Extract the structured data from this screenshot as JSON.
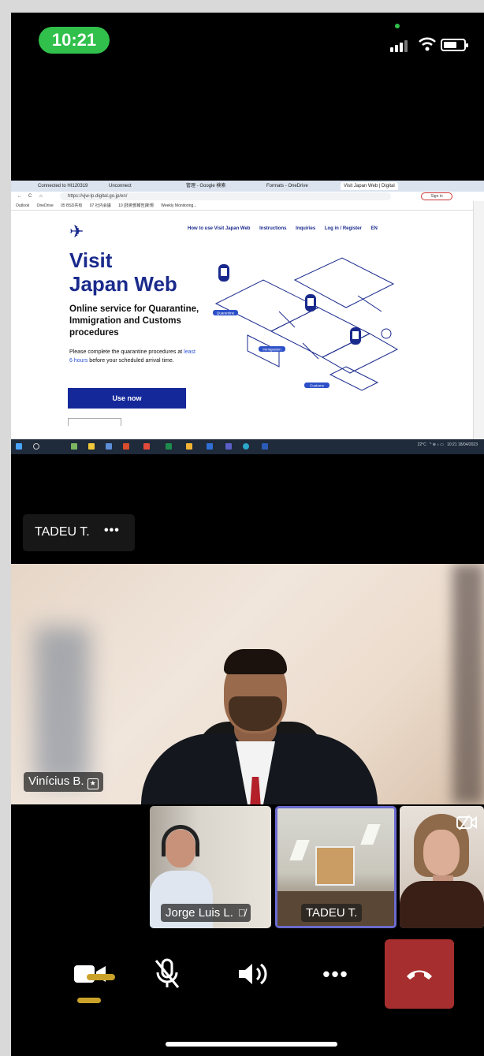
{
  "status_bar": {
    "time": "10:21"
  },
  "shared_screen": {
    "browser": {
      "tabs": [
        "Connected to HI120319",
        "Unconnect",
        "管理 - Google 検索",
        "Formats - OneDrive",
        "Visit Japan Web | Digital"
      ],
      "url": "https://vjw-lp.digital.go.jp/en/",
      "sign_in": "Sign in",
      "favorites": [
        "Outlook",
        "OneDrive",
        "05 BSD共有",
        "07 社内会議",
        "10 [技術部報告]新規",
        "Weekly Monitoring..."
      ]
    },
    "website": {
      "nav": [
        "How to use Visit Japan Web",
        "Instructions",
        "Inquiries",
        "Log in / Register",
        "EN"
      ],
      "title_line1": "Visit",
      "title_line2": "Japan Web",
      "subtitle": "Online service for Quarantine, Immigration and Customs procedures",
      "desc_before": "Please complete the quarantine procedures at ",
      "desc_highlight": "least 6 hours",
      "desc_after": " before your scheduled arrival time.",
      "cta": "Use now",
      "illustration_labels": [
        "Quarantine",
        "Immigration",
        "Customs"
      ]
    },
    "taskbar": {
      "weather": "22°C",
      "clock_time": "10:21",
      "clock_date": "18/04/2023"
    }
  },
  "presenter": {
    "name": "TADEU T.",
    "more": "•••"
  },
  "participants": {
    "main": {
      "name": "Vinícius B."
    },
    "thumbs": [
      {
        "name": "Jorge Luis L."
      },
      {
        "name": "TADEU T."
      },
      {
        "name": ""
      }
    ]
  },
  "controls": {
    "more": "•••"
  },
  "colors": {
    "status_green": "#31c04b",
    "leave_red": "#a62e2e",
    "active_speaker_border": "#6b6bd0",
    "vjw_blue": "#1a2a8c"
  }
}
